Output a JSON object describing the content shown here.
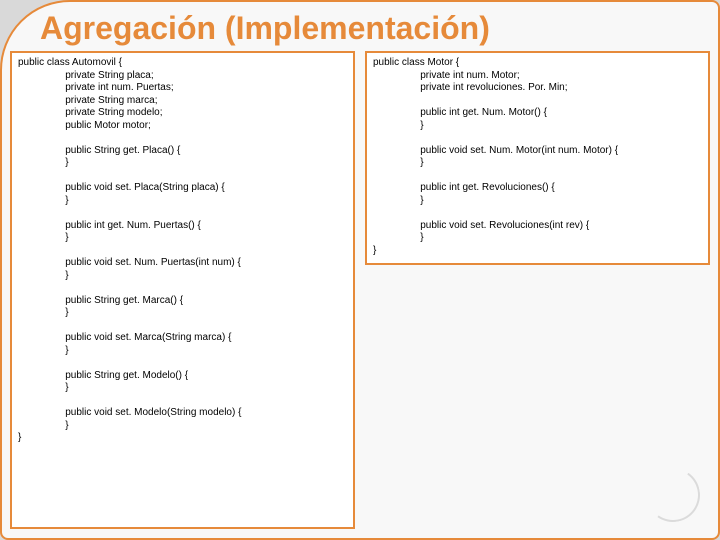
{
  "title": "Agregación (Implementación)",
  "left_code": "public class Automovil {\n                 private String placa;\n                 private int num. Puertas;\n                 private String marca;\n                 private String modelo;\n                 public Motor motor;\n\n                 public String get. Placa() {\n                 }\n\n                 public void set. Placa(String placa) {\n                 }\n\n                 public int get. Num. Puertas() {\n                 }\n\n                 public void set. Num. Puertas(int num) {\n                 }\n\n                 public String get. Marca() {\n                 }\n\n                 public void set. Marca(String marca) {\n                 }\n\n                 public String get. Modelo() {\n                 }\n\n                 public void set. Modelo(String modelo) {\n                 }\n}",
  "right_code": "public class Motor {\n                 private int num. Motor;\n                 private int revoluciones. Por. Min;\n\n                 public int get. Num. Motor() {\n                 }\n\n                 public void set. Num. Motor(int num. Motor) {\n                 }\n\n                 public int get. Revoluciones() {\n                 }\n\n                 public void set. Revoluciones(int rev) {\n                 }\n}"
}
